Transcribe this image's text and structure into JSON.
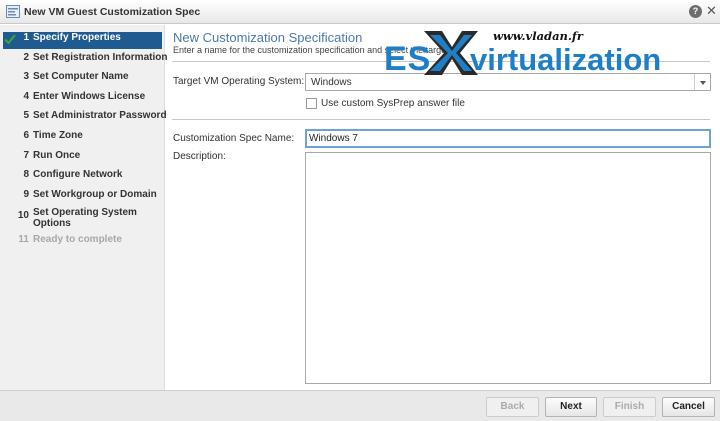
{
  "window": {
    "title": "New VM Guest Customization Spec"
  },
  "steps": [
    {
      "num": "1",
      "label": "Specify Properties"
    },
    {
      "num": "2",
      "label": "Set Registration Information"
    },
    {
      "num": "3",
      "label": "Set Computer Name"
    },
    {
      "num": "4",
      "label": "Enter Windows License"
    },
    {
      "num": "5",
      "label": "Set Administrator Password"
    },
    {
      "num": "6",
      "label": "Time Zone"
    },
    {
      "num": "7",
      "label": "Run Once"
    },
    {
      "num": "8",
      "label": "Configure Network"
    },
    {
      "num": "9",
      "label": "Set Workgroup or Domain"
    },
    {
      "num": "10",
      "label": "Set Operating System Options"
    },
    {
      "num": "11",
      "label": "Ready to complete"
    }
  ],
  "main": {
    "title": "New Customization Specification",
    "subtitle": "Enter a name for the customization specification and select the target",
    "os_label": "Target VM Operating System:",
    "os_value": "Windows",
    "sysprep_label": "Use custom SysPrep answer file",
    "name_label": "Customization Spec Name:",
    "name_value": "Windows 7",
    "description_label": "Description:"
  },
  "watermark": {
    "site": "www.vladan.fr",
    "es": "ES",
    "virt": "virtualization"
  },
  "footer": {
    "back": "Back",
    "next": "Next",
    "finish": "Finish",
    "cancel": "Cancel"
  },
  "colors": {
    "accent": "#1f5a91",
    "title": "#4d7aa8",
    "focus": "#6fa2d4",
    "check": "#3aa83a",
    "logo": "#1f7fc6"
  }
}
